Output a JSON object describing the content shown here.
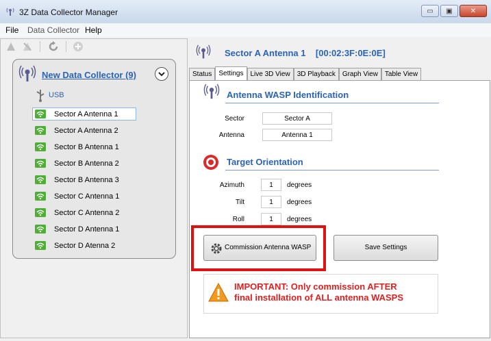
{
  "window": {
    "title": "3Z Data Collector Manager",
    "caption_buttons": [
      "▭",
      "▣",
      "✕"
    ]
  },
  "menu": [
    "File",
    "Data Collector",
    "Help"
  ],
  "collector": {
    "title": "New Data Collector (9)",
    "usb_label": "USB",
    "antennas": [
      "Sector A Antenna 1",
      "Sector A Antenna 2",
      "Sector B Antenna 1",
      "Sector B Antenna 2",
      "Sector B Antenna 3",
      "Sector C Antenna 1",
      "Sector C Antenna 2",
      "Sector D Antenna 1",
      "Sector D Atenna 2"
    ],
    "selected_index": 0
  },
  "device_header": "Sector A Antenna 1    [00:02:3F:0E:0E]",
  "tabs": [
    "Status",
    "Settings",
    "Live 3D View",
    "3D Playback",
    "Graph View",
    "Table View"
  ],
  "active_tab": "Settings",
  "identification": {
    "title": "Antenna WASP Identification",
    "sector_label": "Sector",
    "sector_value": "Sector A",
    "antenna_label": "Antenna",
    "antenna_value": "Antenna 1"
  },
  "orientation": {
    "title": "Target Orientation",
    "azimuth_label": "Azimuth",
    "azimuth_value": "1",
    "tilt_label": "Tilt",
    "tilt_value": "1",
    "roll_label": "Roll",
    "roll_value": "1",
    "unit": "degrees"
  },
  "buttons": {
    "commission": "Commission Antenna WASP",
    "save": "Save Settings"
  },
  "warning": {
    "line1": "IMPORTANT: Only commission AFTER",
    "line2": "final installation of ALL antenna WASPS"
  },
  "colors": {
    "accent": "#2a63b8",
    "highlight": "#e01010",
    "wifi": "#4fae35"
  }
}
